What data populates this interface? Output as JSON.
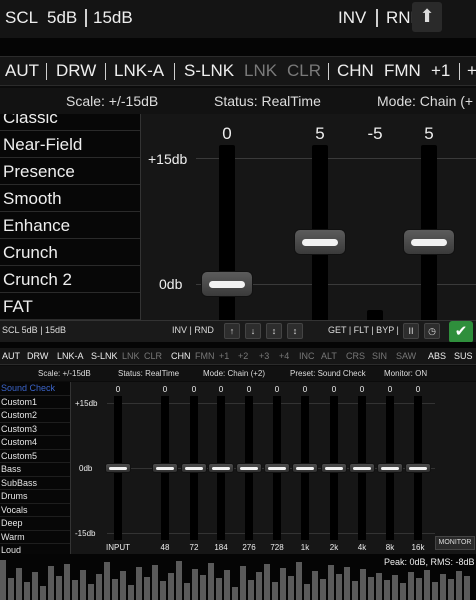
{
  "top_bar": {
    "scl": "SCL",
    "v1": "5dB",
    "v2": "15dB",
    "inv": "INV",
    "rnd": "RND",
    "up_icon": "up-arrow-icon"
  },
  "chain_bar": {
    "items": [
      "AUT",
      "DRW",
      "LNK-A",
      "S-LNK",
      "LNK",
      "CLR",
      "CHN",
      "FMN",
      "+1",
      "+"
    ]
  },
  "info_bar": {
    "scale": "Scale: +/-15dB",
    "status": "Status: RealTime",
    "mode": "Mode: Chain (+"
  },
  "presets_zoom": [
    "Classic",
    "Near-Field",
    "Presence",
    "Smooth",
    "Enhance",
    "Crunch",
    "Crunch 2",
    "FAT"
  ],
  "eq_zoom": {
    "values": [
      "0",
      "5",
      "-5",
      "5"
    ],
    "scale_top": "+15db",
    "scale_mid": "0db"
  },
  "control_bar": {
    "scl": "SCL 5dB | 15dB",
    "inv": "INV | RND",
    "arrows": [
      "↑",
      "↓",
      "↕",
      "↕"
    ],
    "get": "GET | FLT | BYP |",
    "pause_icon": "pause-icon",
    "clock_icon": "clock-icon",
    "check_icon": "check-icon"
  },
  "chain_bar2": {
    "items": [
      "AUT",
      "DRW",
      "LNK-A",
      "S-LNK",
      "LNK",
      "CLR",
      "CHN",
      "FMN",
      "+1",
      "+2",
      "+3",
      "+4",
      "INC",
      "ALT",
      "CRS",
      "SIN",
      "SAW",
      "ABS",
      "SUS"
    ]
  },
  "info_bar2": {
    "scale": "Scale: +/-15dB",
    "status": "Status: RealTime",
    "mode": "Mode: Chain (+2)",
    "preset": "Preset: Sound Check",
    "monitor": "Monitor: ON"
  },
  "preset_list": [
    "Sound Check",
    "Custom1",
    "Custom2",
    "Custom3",
    "Custom4",
    "Custom5",
    "Bass",
    "SubBass",
    "Drums",
    "Vocals",
    "Deep",
    "Warm",
    "Loud"
  ],
  "eq_main": {
    "values": [
      "0",
      "0",
      "0",
      "0",
      "0",
      "0",
      "0",
      "0",
      "0",
      "0",
      "0",
      "0"
    ],
    "labels": [
      "INPUT",
      "48",
      "72",
      "184",
      "276",
      "728",
      "1k",
      "2k",
      "4k",
      "8k",
      "16k"
    ],
    "scale_top": "+15db",
    "scale_mid": "0db",
    "scale_bot": "-15db",
    "monitor": "MONITOR"
  },
  "peak": {
    "text": "Peak: 0dB, RMS: -8dB"
  },
  "colors": {
    "accent_green": "#2f8f3c",
    "selected_blue": "#3b64c9",
    "dim_text": "#7a7a7a"
  }
}
